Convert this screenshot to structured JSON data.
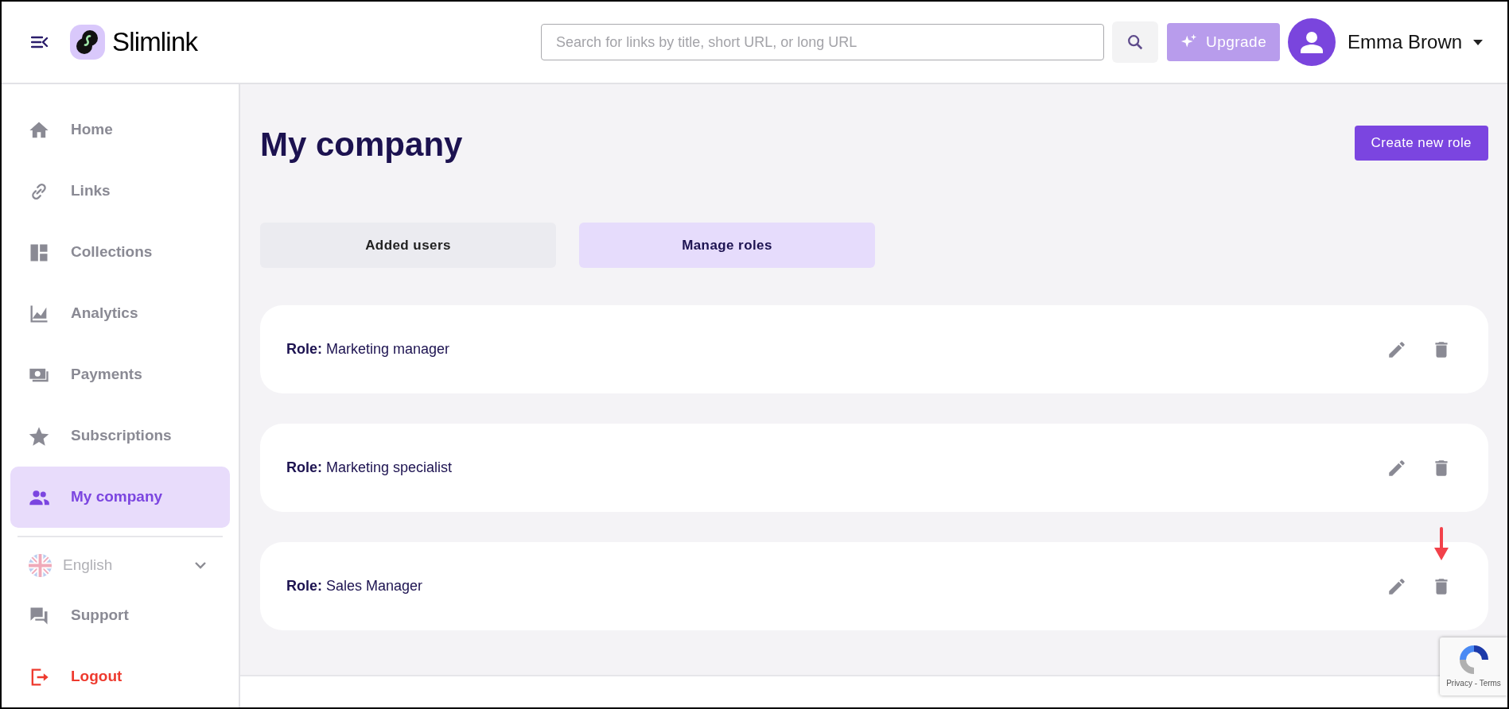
{
  "header": {
    "logo_text": "Slimlink",
    "search": {
      "placeholder": "Search for links by title, short URL, or long URL"
    },
    "upgrade_button": "Upgrade",
    "user_name": "Emma Brown"
  },
  "sidebar": {
    "items": [
      {
        "label": "Home",
        "kind": "home",
        "selected": false
      },
      {
        "label": "Links",
        "kind": "link",
        "selected": false
      },
      {
        "label": "Collections",
        "kind": "collections",
        "selected": false
      },
      {
        "label": "Analytics",
        "kind": "analytics",
        "selected": false
      },
      {
        "label": "Payments",
        "kind": "payments",
        "selected": false
      },
      {
        "label": "Subscriptions",
        "kind": "star",
        "selected": false
      },
      {
        "label": "My company",
        "kind": "people",
        "selected": true
      }
    ],
    "language": "English",
    "bottom_items": [
      {
        "label": "Support",
        "kind": "support"
      },
      {
        "label": "Logout",
        "kind": "logout"
      }
    ]
  },
  "page": {
    "title": "My company",
    "create_button": "Create new role",
    "tabs": [
      {
        "label": "Added users",
        "selected": false
      },
      {
        "label": "Manage roles",
        "selected": true
      }
    ],
    "roles": [
      {
        "prefix": "Role:",
        "name": "Marketing manager"
      },
      {
        "prefix": "Role:",
        "name": "Marketing specialist"
      },
      {
        "prefix": "Role:",
        "name": "Sales Manager"
      }
    ]
  },
  "recaptcha": {
    "links": "Privacy - Terms"
  }
}
